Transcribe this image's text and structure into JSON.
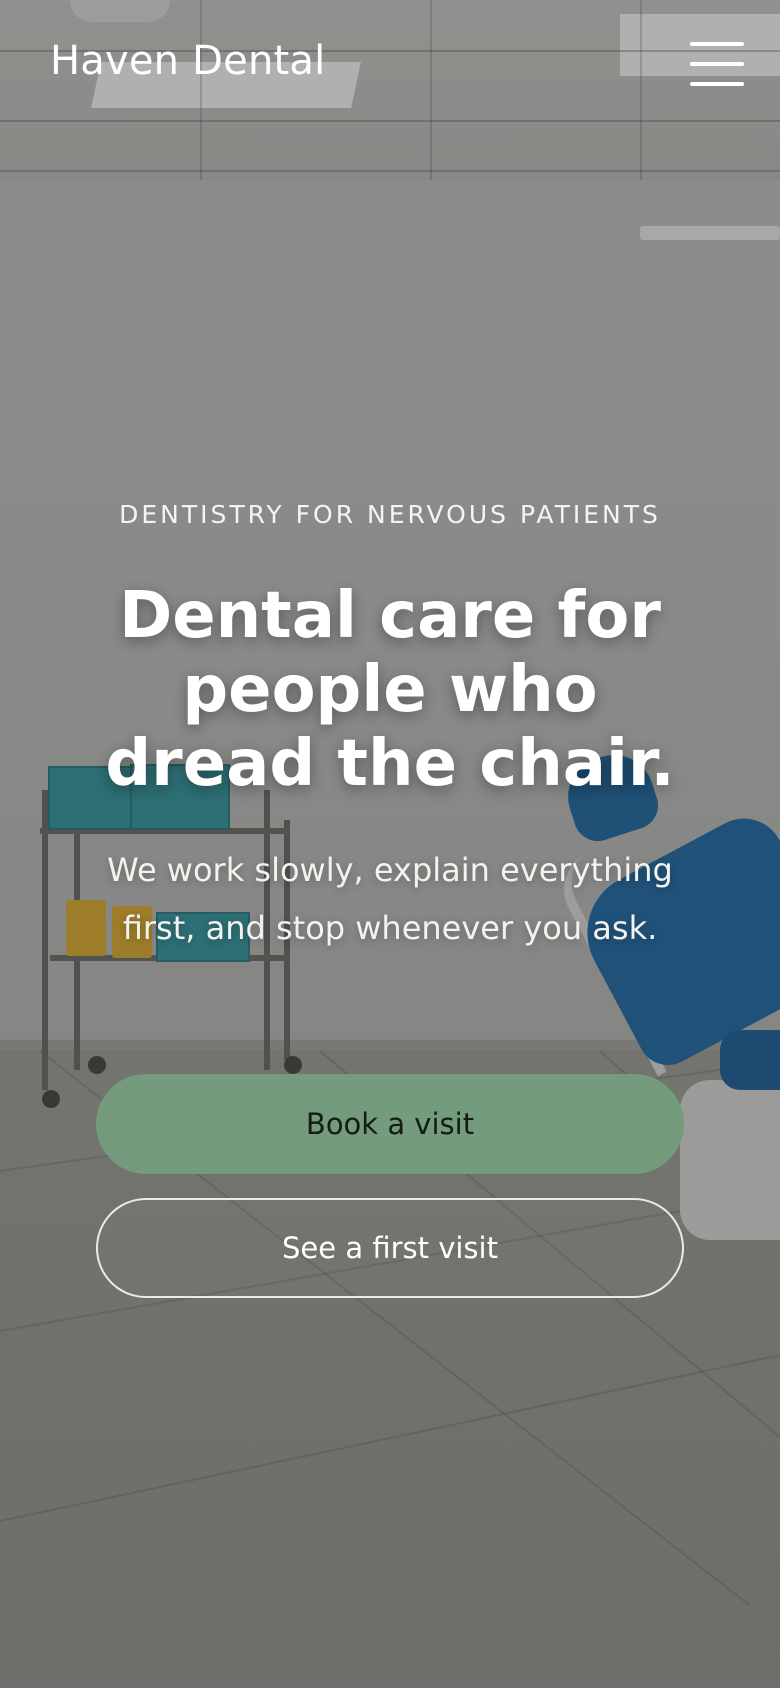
{
  "header": {
    "brand": "Haven Dental",
    "menu_icon": "hamburger-menu-icon"
  },
  "hero": {
    "eyebrow": "DENTISTRY FOR NERVOUS PATIENTS",
    "headline": "Dental care for people who dread the chair.",
    "subtext": "We work slowly, explain everything first, and stop whenever you ask."
  },
  "actions": {
    "primary_label": "Book a visit",
    "secondary_label": "See a first visit"
  },
  "colors": {
    "primary_button": "#739b7c",
    "text": "#ffffff"
  }
}
